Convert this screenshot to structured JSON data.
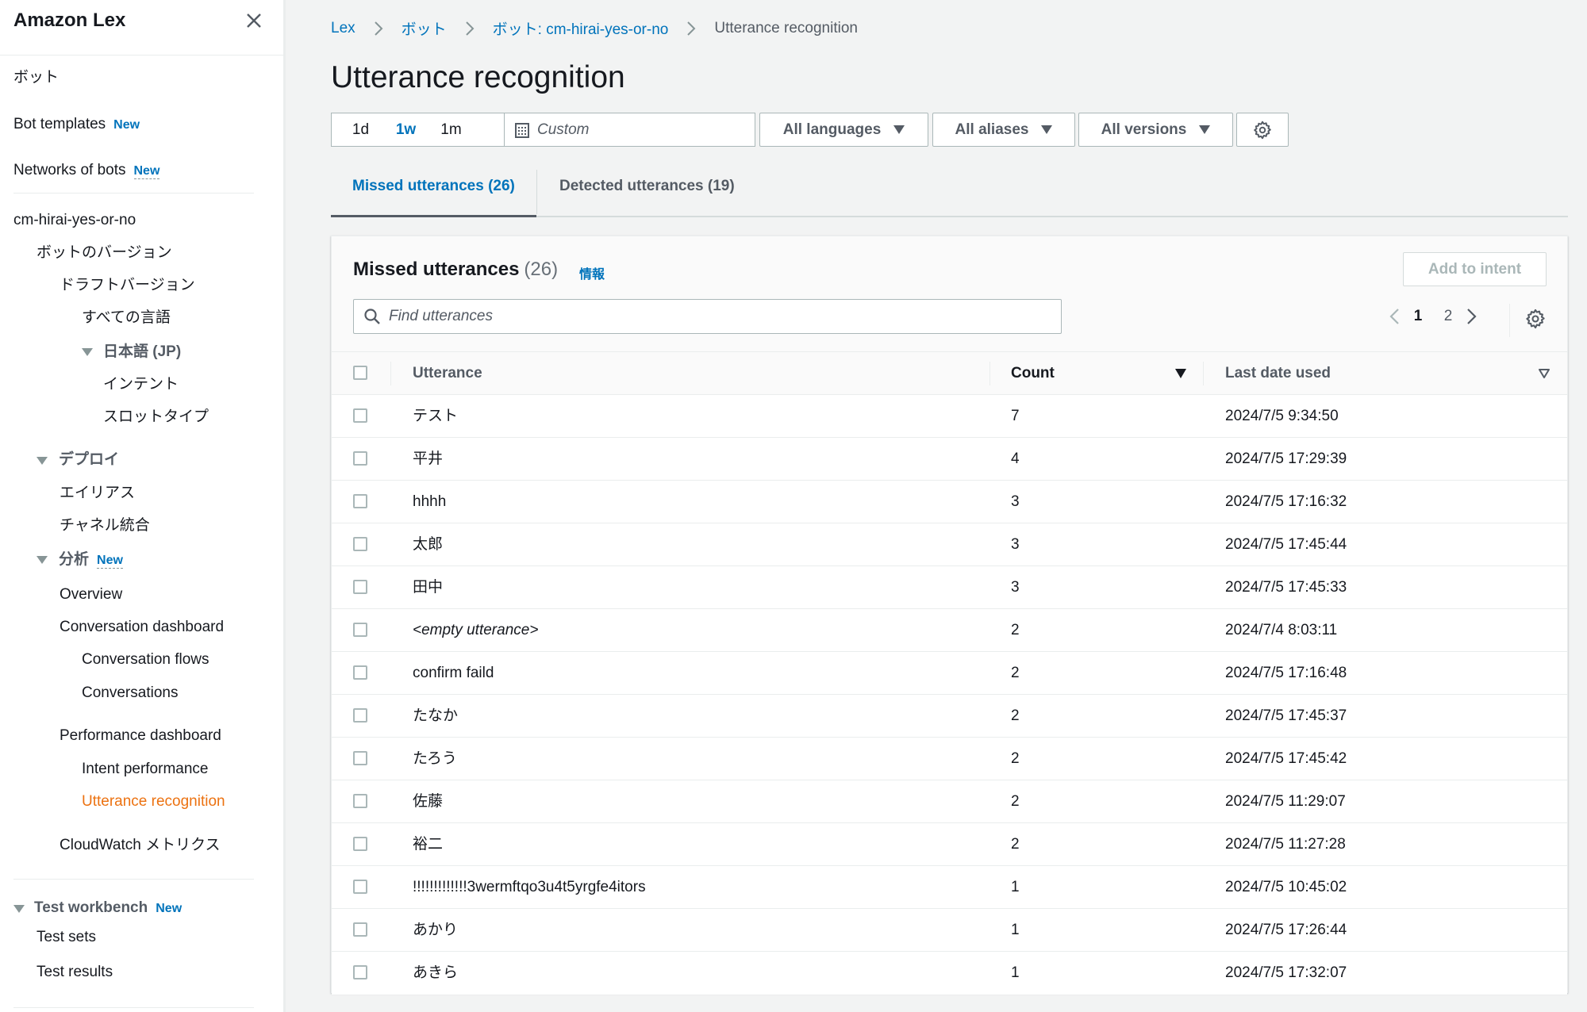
{
  "sidebar": {
    "title": "Amazon Lex",
    "items": {
      "bots": "ボット",
      "bot_templates": "Bot templates",
      "networks_of_bots": "Networks of bots",
      "bot_name": "cm-hirai-yes-or-no",
      "bot_versions": "ボットのバージョン",
      "draft_version": "ドラフトバージョン",
      "all_languages": "すべての言語",
      "japanese": "日本語 (JP)",
      "intents": "インテント",
      "slot_types": "スロットタイプ",
      "deploy": "デプロイ",
      "aliases": "エイリアス",
      "channel_integrations": "チャネル統合",
      "analytics": "分析",
      "overview": "Overview",
      "conversation_dashboard": "Conversation dashboard",
      "conversation_flows": "Conversation flows",
      "conversations": "Conversations",
      "performance_dashboard": "Performance dashboard",
      "intent_performance": "Intent performance",
      "utterance_recognition": "Utterance recognition",
      "cloudwatch_metrics": "CloudWatch メトリクス",
      "test_workbench": "Test workbench",
      "test_sets": "Test sets",
      "test_results": "Test results"
    },
    "new_badge": "New"
  },
  "breadcrumb": {
    "items": [
      "Lex",
      "ボット",
      "ボット: cm-hirai-yes-or-no"
    ],
    "current": "Utterance recognition"
  },
  "page_title": "Utterance recognition",
  "filters": {
    "ranges": [
      "1d",
      "1w",
      "1m"
    ],
    "selected_range": "1w",
    "custom_placeholder": "Custom",
    "languages": "All languages",
    "aliases": "All aliases",
    "versions": "All versions"
  },
  "tabs": [
    {
      "label": "Missed utterances (26)",
      "active": true
    },
    {
      "label": "Detected utterances (19)",
      "active": false
    }
  ],
  "panel": {
    "title": "Missed utterances",
    "count": "(26)",
    "info_link": "情報",
    "add_to_intent": "Add to intent",
    "search_placeholder": "Find utterances",
    "pagination": {
      "pages": [
        "1",
        "2"
      ],
      "current": "1"
    },
    "columns": {
      "utterance": "Utterance",
      "count": "Count",
      "last_date": "Last date used"
    },
    "rows": [
      {
        "utterance": "テスト",
        "count": "7",
        "last_date": "2024/7/5 9:34:50"
      },
      {
        "utterance": "平井",
        "count": "4",
        "last_date": "2024/7/5 17:29:39"
      },
      {
        "utterance": "hhhh",
        "count": "3",
        "last_date": "2024/7/5 17:16:32"
      },
      {
        "utterance": "太郎",
        "count": "3",
        "last_date": "2024/7/5 17:45:44"
      },
      {
        "utterance": "田中",
        "count": "3",
        "last_date": "2024/7/5 17:45:33"
      },
      {
        "utterance": "<empty utterance>",
        "count": "2",
        "last_date": "2024/7/4 8:03:11",
        "italic": true
      },
      {
        "utterance": "confirm faild",
        "count": "2",
        "last_date": "2024/7/5 17:16:48"
      },
      {
        "utterance": "たなか",
        "count": "2",
        "last_date": "2024/7/5 17:45:37"
      },
      {
        "utterance": "たろう",
        "count": "2",
        "last_date": "2024/7/5 17:45:42"
      },
      {
        "utterance": "佐藤",
        "count": "2",
        "last_date": "2024/7/5 11:29:07"
      },
      {
        "utterance": "裕二",
        "count": "2",
        "last_date": "2024/7/5 11:27:28"
      },
      {
        "utterance": "!!!!!!!!!!!!!3wermftqo3u4t5yrgfe4itors",
        "count": "1",
        "last_date": "2024/7/5 10:45:02"
      },
      {
        "utterance": "あかり",
        "count": "1",
        "last_date": "2024/7/5 17:26:44"
      },
      {
        "utterance": "あきら",
        "count": "1",
        "last_date": "2024/7/5 17:32:07"
      }
    ]
  },
  "colors": {
    "link": "#0073bb",
    "active_nav": "#ec7211",
    "page_bg": "#f2f3f3"
  }
}
